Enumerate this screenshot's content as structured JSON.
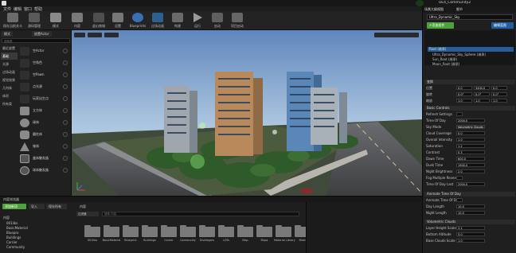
{
  "window": {
    "project_title": "UE4_Community2"
  },
  "menu": [
    "文件",
    "编辑",
    "窗口",
    "帮助"
  ],
  "toolbar": [
    {
      "label": "保存当前关卡",
      "icon": "save-icon"
    },
    {
      "label": "源码管理",
      "icon": "source-control-icon"
    },
    {
      "label": "模式",
      "icon": "modes-icon"
    },
    {
      "label": "内容",
      "icon": "content-icon"
    },
    {
      "label": "虚幻商城",
      "icon": "marketplace-icon"
    },
    {
      "label": "设置",
      "icon": "settings-icon"
    },
    {
      "label": "Blueprints",
      "icon": "blueprint-icon"
    },
    {
      "label": "过场动画",
      "icon": "cinematics-icon"
    },
    {
      "label": "构建",
      "icon": "build-icon"
    },
    {
      "label": "运行",
      "icon": "play-icon"
    },
    {
      "label": "启动",
      "icon": "launch-icon"
    },
    {
      "label": "项目启动",
      "icon": "project-launch-icon"
    }
  ],
  "left_panel": {
    "tabs": [
      "模式",
      "放置Actor"
    ],
    "search_placeholder": "搜索类",
    "categories": [
      "最近放置",
      "基础",
      "光源",
      "过场动画",
      "视觉效果",
      "几何体",
      "体积",
      "所有类"
    ],
    "items": [
      "空Actor",
      "空角色",
      "空Pawn",
      "点光源",
      "玩家出生点",
      "立方体",
      "球体",
      "圆柱体",
      "锥体",
      "盒体触发器",
      "球体触发器"
    ]
  },
  "content_browser": {
    "tab": "内容浏览器",
    "add_button": "添加新项",
    "import_button": "导入",
    "save_all_button": "保存所有",
    "path": "内容",
    "filter_label": "过滤器",
    "search_placeholder": "搜索 内容",
    "tree": [
      "内容",
      "001libs",
      "BasicMaterial",
      "Bluepro",
      "Buildings",
      "Carrier",
      "Community"
    ],
    "folders": [
      "001libs",
      "BasicMaterial",
      "Blueprint",
      "Buildings",
      "Carrier",
      "Community",
      "Dividegers",
      "LDTs",
      "Map",
      "Maps",
      "Material Library",
      "Mesh"
    ]
  },
  "right_panel": {
    "scene_tabs": [
      "场景大纲视图",
      "细节"
    ],
    "selected_actor": "Ultra_Dynamic_Sky",
    "add_component": "+添加组件",
    "edit_blueprint": "编辑蓝图",
    "outline": [
      "Root (继承)",
      "Ultra_Dynamic_Sky_Sphere (继承)",
      "Sun_Root (继承)",
      "Moon_Root (继承)"
    ],
    "transform": {
      "header": "变换",
      "rows": [
        {
          "label": "位置",
          "x": "0.0",
          "y": "3400.0",
          "z": "0.0"
        },
        {
          "label": "旋转",
          "x": "0.0°",
          "y": "0.0°",
          "z": "0.0°"
        },
        {
          "label": "缩放",
          "x": "1.0",
          "y": "1.0",
          "z": "1.0"
        }
      ]
    },
    "basic_controls": {
      "header": "Basic Controls",
      "rows": [
        {
          "label": "Refresh Settings",
          "value": ""
        },
        {
          "label": "Time Of Day",
          "value": "2000.0"
        },
        {
          "label": "Sky Mode",
          "value": "Volumetric Clouds"
        },
        {
          "label": "Cloud Coverage",
          "value": "0.0"
        },
        {
          "label": "Overall Intensity",
          "value": "1.0"
        },
        {
          "label": "Saturation",
          "value": "1.2"
        },
        {
          "label": "Contrast",
          "value": "0.3"
        },
        {
          "label": "Dawn Time",
          "value": "600.0"
        },
        {
          "label": "Dusk Time",
          "value": "1900.0"
        },
        {
          "label": "Night Brightness",
          "value": "2.0"
        },
        {
          "label": "Fog Multiple Reverse",
          "value": ""
        },
        {
          "label": "Time Of Day Last",
          "value": "2000.0"
        }
      ]
    },
    "animate_time": {
      "header": "Animate Time Of Day",
      "rows": [
        {
          "label": "Animate Time Of Day",
          "value": ""
        },
        {
          "label": "Day Length",
          "value": "10.0"
        },
        {
          "label": "Night Length",
          "value": "10.0"
        }
      ]
    },
    "volumetric": {
      "header": "Volumetric Clouds",
      "rows": [
        {
          "label": "Layer Height Scale",
          "value": "3.1"
        },
        {
          "label": "Bottom Altitude",
          "value": "5.0"
        },
        {
          "label": "Base Clouds Scale",
          "value": "1.0"
        }
      ]
    }
  },
  "colors": {
    "accent_green": "#4ea23b",
    "selection_blue": "#235fa0",
    "viewport_sky": "#7d9cc7"
  }
}
